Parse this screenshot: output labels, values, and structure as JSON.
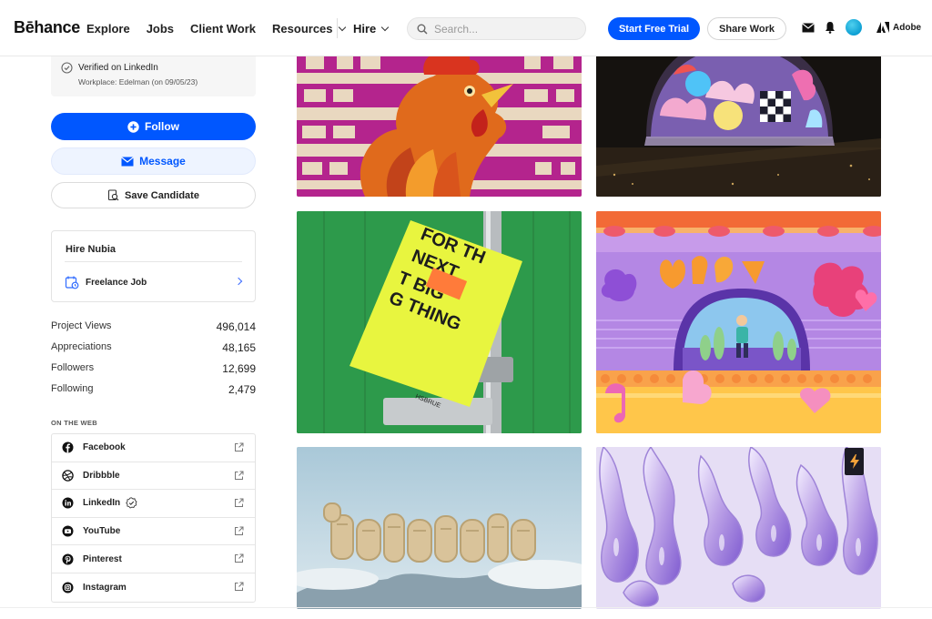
{
  "header": {
    "logo": "Bēhance",
    "nav": {
      "explore": "Explore",
      "jobs": "Jobs",
      "client_work": "Client Work",
      "resources": "Resources"
    },
    "hire": "Hire",
    "search_placeholder": "Search...",
    "start_trial": "Start Free Trial",
    "share_work": "Share Work",
    "adobe": "Adobe"
  },
  "sidebar": {
    "verified": {
      "title": "Verified on LinkedIn",
      "subtitle": "Workplace: Edelman (on 09/05/23)"
    },
    "follow": "Follow",
    "message": "Message",
    "save_candidate": "Save Candidate",
    "hire_box": {
      "title": "Hire Nubia",
      "freelance": "Freelance Job"
    },
    "stats": [
      {
        "label": "Project Views",
        "value": "496,014"
      },
      {
        "label": "Appreciations",
        "value": "48,165"
      },
      {
        "label": "Followers",
        "value": "12,699"
      },
      {
        "label": "Following",
        "value": "2,479"
      }
    ],
    "on_the_web_title": "ON THE WEB",
    "web_links": [
      {
        "label": "Facebook",
        "icon": "facebook-icon"
      },
      {
        "label": "Dribbble",
        "icon": "dribbble-icon"
      },
      {
        "label": "LinkedIn",
        "icon": "linkedin-icon"
      },
      {
        "label": "YouTube",
        "icon": "youtube-icon"
      },
      {
        "label": "Pinterest",
        "icon": "pinterest-icon"
      },
      {
        "label": "Instagram",
        "icon": "instagram-icon"
      }
    ]
  },
  "colors": {
    "accent": "#0057ff",
    "message_bg": "#eef4ff"
  }
}
